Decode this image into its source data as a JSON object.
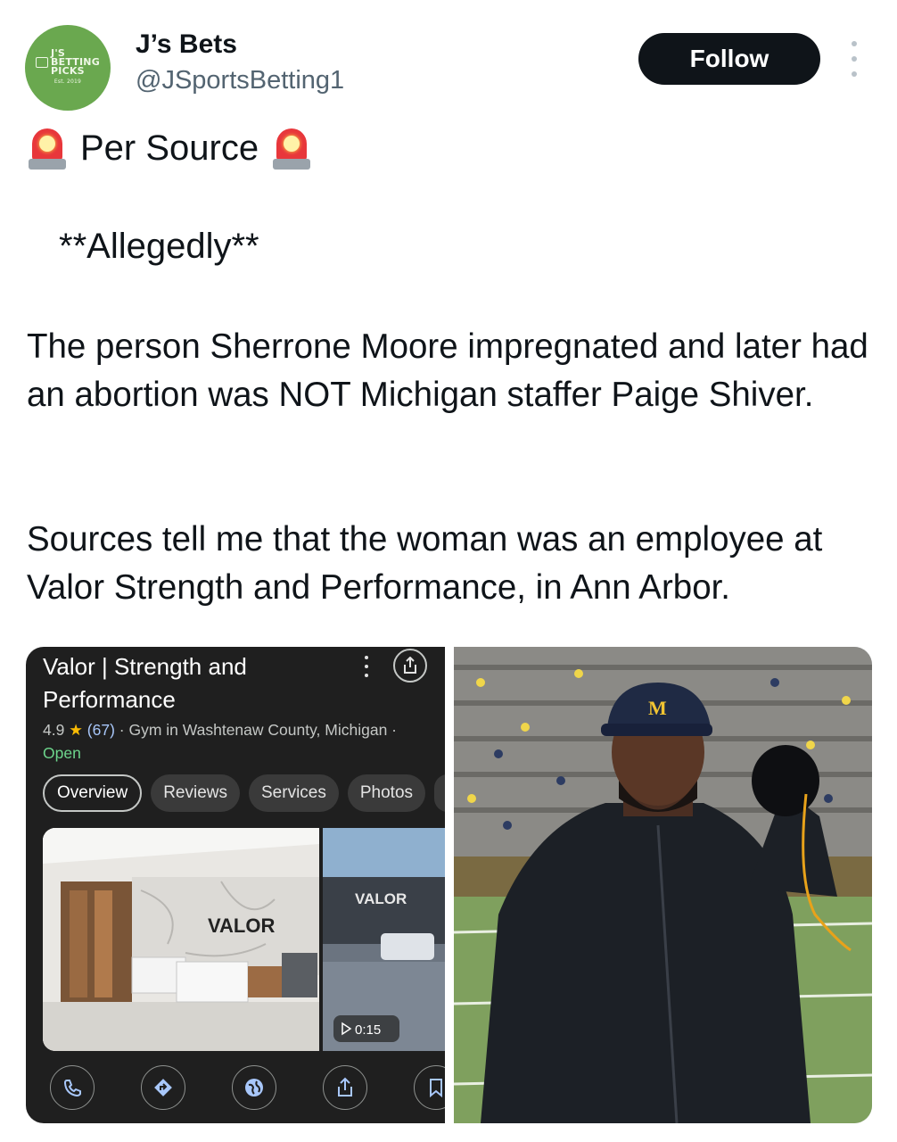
{
  "profile": {
    "avatar_logo_line1": "J'S",
    "avatar_logo_line2": "BETTING",
    "avatar_logo_line3": "PICKS",
    "avatar_logo_small": "Est. 2019",
    "name": "J’s Bets",
    "handle": "@JSportsBetting1",
    "follow_label": "Follow",
    "avatar_color": "#6aa84f"
  },
  "tweet": {
    "headline": "Per Source",
    "headline_icon": "police-car-light-icon",
    "allegedly": "**Allegedly**",
    "para1": "The person Sherrone Moore impregnated and later had an abortion was NOT Michigan staffer Paige Shiver.",
    "para2": "Sources tell me that the woman was an employee at Valor Strength and Performance, in Ann Arbor."
  },
  "maps_card": {
    "title": "Valor | Strength and Performance",
    "rating": "4.9",
    "reviews_count": "(67)",
    "category": "· Gym in Washtenaw County, Michigan ·",
    "status": "Open",
    "tabs": [
      "Overview",
      "Reviews",
      "Services",
      "Photos"
    ],
    "photo_a_sign": "VALOR",
    "photo_b_sign": "VALOR",
    "video_duration": "0:15",
    "actions": [
      "Call",
      "Directions",
      "Website",
      "Share",
      "Save"
    ]
  },
  "coach_photo": {
    "cap_letter": "M"
  }
}
